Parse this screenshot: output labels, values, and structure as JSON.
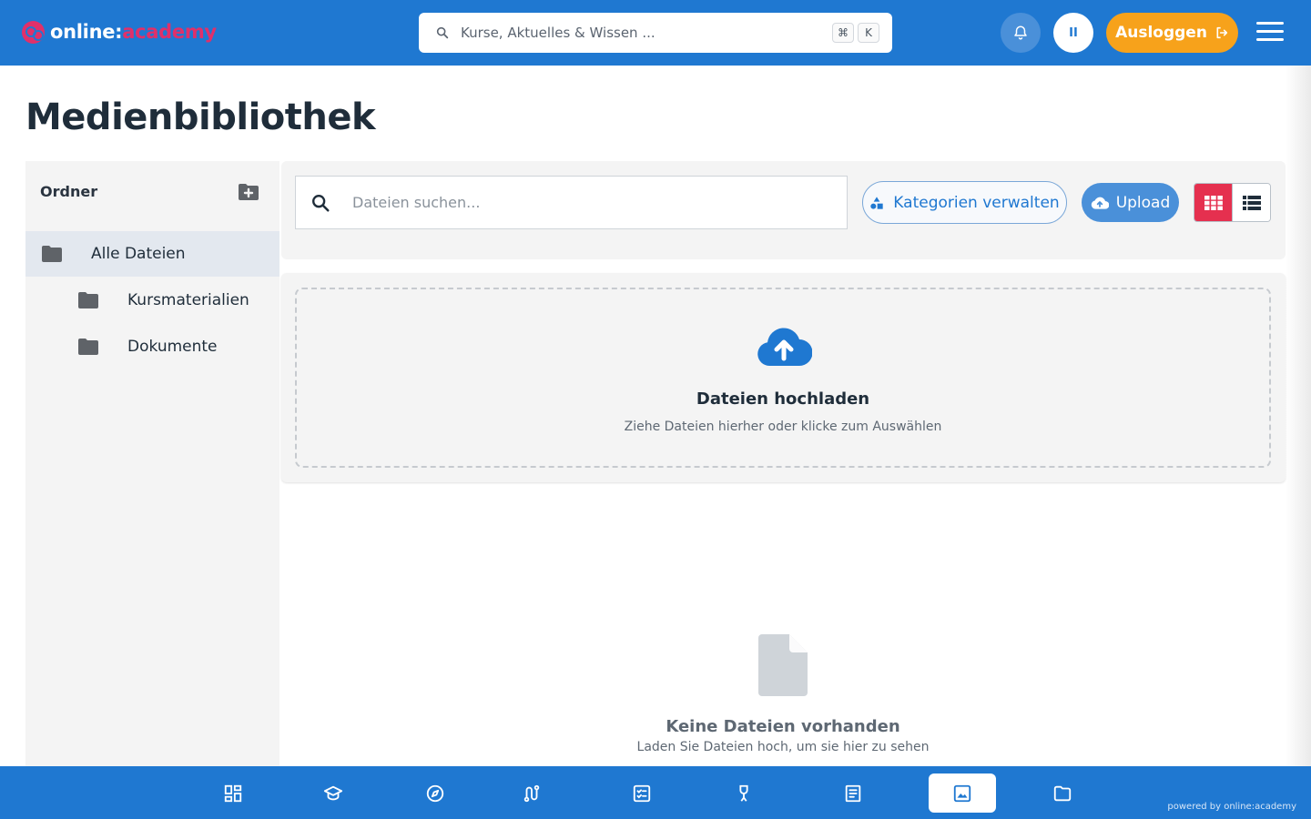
{
  "header": {
    "logo_primary": "online:",
    "logo_accent": "academy",
    "search_placeholder": "Kurse, Aktuelles & Wissen ...",
    "shortcut_keys": [
      "⌘",
      "K"
    ],
    "avatar_initials": "II",
    "logout_label": "Ausloggen"
  },
  "page": {
    "title": "Medienbibliothek"
  },
  "sidebar": {
    "heading": "Ordner",
    "folders": [
      {
        "label": "Alle Dateien",
        "active": true,
        "level": 0
      },
      {
        "label": "Kursmaterialien",
        "active": false,
        "level": 1
      },
      {
        "label": "Dokumente",
        "active": false,
        "level": 1
      }
    ]
  },
  "toolbar": {
    "search_placeholder": "Dateien suchen...",
    "categories_label": "Kategorien verwalten",
    "upload_label": "Upload",
    "active_view": "grid"
  },
  "dropzone": {
    "title": "Dateien hochladen",
    "subtitle": "Ziehe Dateien hierher oder klicke zum Auswählen"
  },
  "empty_state": {
    "title": "Keine Dateien vorhanden",
    "subtitle": "Laden Sie Dateien hoch, um sie hier zu sehen"
  },
  "bottom_nav": {
    "items": [
      {
        "icon": "dashboard-icon",
        "active": false
      },
      {
        "icon": "graduation-cap-icon",
        "active": false
      },
      {
        "icon": "compass-icon",
        "active": false
      },
      {
        "icon": "route-icon",
        "active": false
      },
      {
        "icon": "checklist-icon",
        "active": false
      },
      {
        "icon": "trophy-icon",
        "active": false
      },
      {
        "icon": "article-icon",
        "active": false
      },
      {
        "icon": "image-icon",
        "active": true
      },
      {
        "icon": "folder-icon",
        "active": false
      }
    ],
    "powered_by": "powered by online:academy"
  },
  "colors": {
    "brand_blue": "#1f78d1",
    "accent_pink": "#e0306a",
    "logout_orange": "#f7a21b",
    "upload_blue": "#4a90d9",
    "grid_active_red": "#e5304f"
  }
}
